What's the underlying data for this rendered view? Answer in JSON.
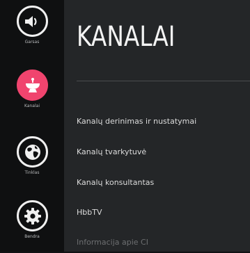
{
  "sidebar": {
    "items": [
      {
        "label": "Garsas",
        "icon": "speaker-icon",
        "active": false
      },
      {
        "label": "Kanalai",
        "icon": "satellite-dish-icon",
        "active": true
      },
      {
        "label": "Tinklas",
        "icon": "globe-icon",
        "active": false
      },
      {
        "label": "Bendra",
        "icon": "gear-icon",
        "active": false
      }
    ]
  },
  "main": {
    "title": "KANALAI",
    "menu": [
      {
        "label": "Kanalų derinimas ir nustatymai",
        "enabled": true
      },
      {
        "label": "Kanalų tvarkytuvė",
        "enabled": true
      },
      {
        "label": "Kanalų konsultantas",
        "enabled": true
      },
      {
        "label": "HbbTV",
        "enabled": true
      },
      {
        "label": "Informacija apie CI",
        "enabled": false
      }
    ]
  },
  "colors": {
    "accent": "#f0446e",
    "sidebar_bg": "#0f1011",
    "panel_bg": "#242628",
    "disabled_text": "#6d6f71"
  }
}
